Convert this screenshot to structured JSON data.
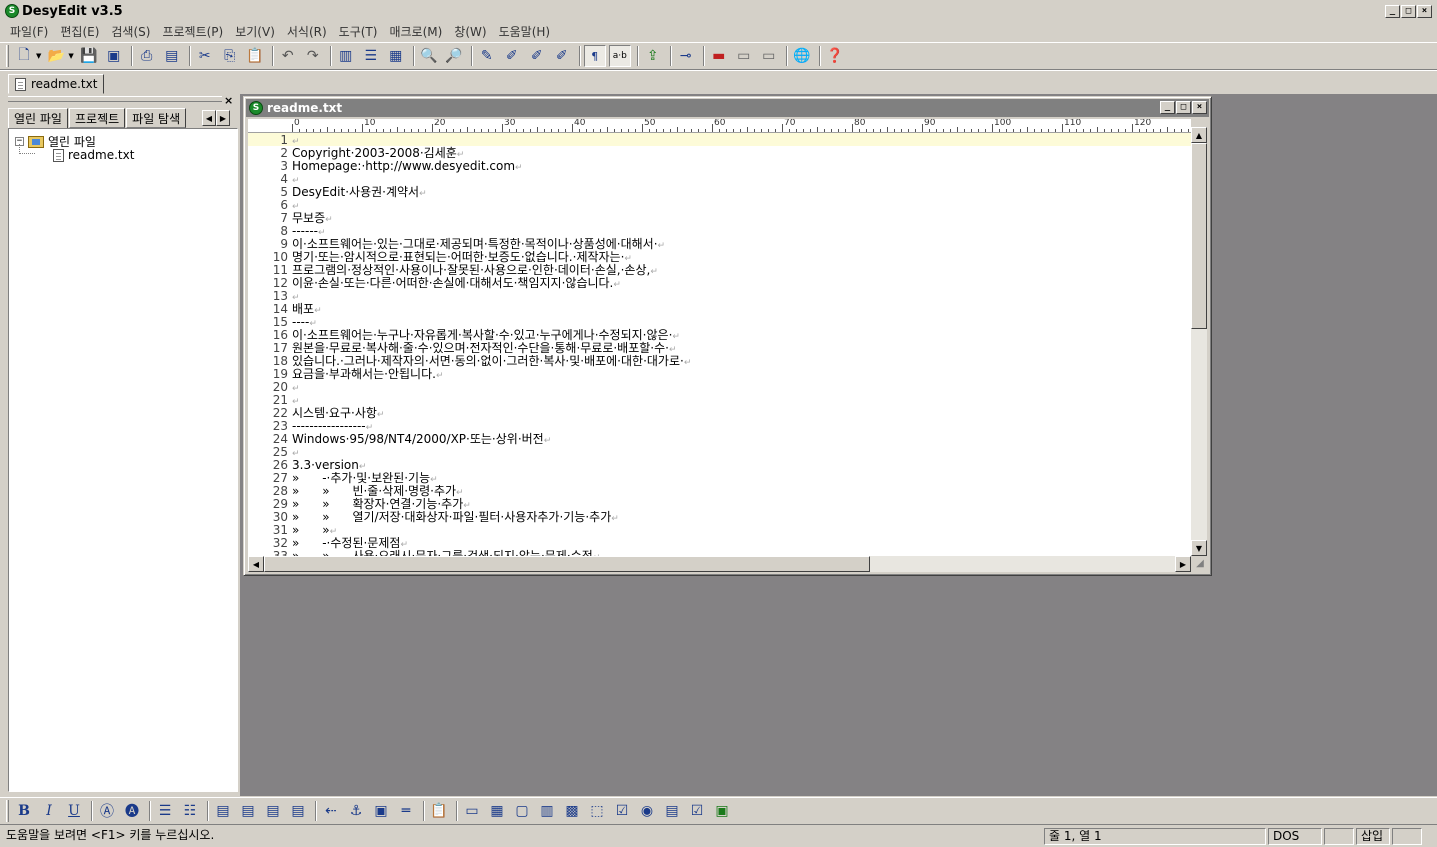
{
  "app": {
    "title": "DesyEdit v3.5",
    "icon": "S"
  },
  "menu": [
    "파일(F)",
    "편집(E)",
    "검색(S)",
    "프로젝트(P)",
    "보기(V)",
    "서식(R)",
    "도구(T)",
    "매크로(M)",
    "창(W)",
    "도움말(H)"
  ],
  "toolbar": {
    "icons": [
      "new-file-icon",
      "open-folder-icon",
      "save-icon",
      "save-all-icon",
      "print-icon",
      "print-preview-icon",
      "cut-icon",
      "copy-icon",
      "paste-icon",
      "undo-icon",
      "redo-icon",
      "column-icon",
      "list-icon",
      "grid-icon",
      "find-icon",
      "replace-icon",
      "highlight-icon",
      "tool-a-icon",
      "tool-b-icon",
      "tool-c-icon",
      "whitespace-icon",
      "word-wrap-icon",
      "export-icon",
      "pin-icon",
      "bookmark-icon",
      "comment-icon",
      "comment2-icon",
      "web-icon",
      "help-icon"
    ],
    "word_wrap_label": "a·b"
  },
  "doc_tabs": [
    {
      "label": "readme.txt"
    }
  ],
  "left_panel": {
    "close": "×",
    "tabs": [
      "열린 파일",
      "프로젝트",
      "파일 탐색"
    ],
    "tree_root": "열린 파일",
    "tree_child": "readme.txt",
    "expander": "−"
  },
  "editor": {
    "title": "readme.txt",
    "ruler_labels": [
      "0",
      "10",
      "20",
      "30",
      "40",
      "50",
      "60",
      "70",
      "80",
      "90",
      "100",
      "110",
      "120"
    ],
    "lines": [
      {
        "n": "1",
        "t": ""
      },
      {
        "n": "2",
        "t": "Copyright·2003-2008·김세훈"
      },
      {
        "n": "3",
        "t": "Homepage:·http://www.desyedit.com"
      },
      {
        "n": "4",
        "t": ""
      },
      {
        "n": "5",
        "t": "DesyEdit·사용권·계약서"
      },
      {
        "n": "6",
        "t": ""
      },
      {
        "n": "7",
        "t": "무보증"
      },
      {
        "n": "8",
        "t": "------"
      },
      {
        "n": "9",
        "t": "이·소프트웨어는·있는·그대로·제공되며·특정한·목적이나·상품성에·대해서·"
      },
      {
        "n": "10",
        "t": "명기·또는·암시적으로·표현되는·어떠한·보증도·없습니다.·제작자는·"
      },
      {
        "n": "11",
        "t": "프로그램의·정상적인·사용이나·잘못된·사용으로·인한·데이터·손실,·손상,"
      },
      {
        "n": "12",
        "t": "이윤·손실·또는·다른·어떠한·손실에·대해서도·책임지지·않습니다."
      },
      {
        "n": "13",
        "t": ""
      },
      {
        "n": "14",
        "t": "배포"
      },
      {
        "n": "15",
        "t": "----"
      },
      {
        "n": "16",
        "t": "이·소프트웨어는·누구나·자유롭게·복사할·수·있고·누구에게나·수정되지·않은·"
      },
      {
        "n": "17",
        "t": "원본을·무료로·복사해·줄·수·있으며·전자적인·수단을·통해·무료로·배포할·수·"
      },
      {
        "n": "18",
        "t": "있습니다.·그러나·제작자의·서면·동의·없이·그러한·복사·및·배포에·대한·대가로·"
      },
      {
        "n": "19",
        "t": "요금을·부과해서는·안됩니다."
      },
      {
        "n": "20",
        "t": ""
      },
      {
        "n": "21",
        "t": ""
      },
      {
        "n": "22",
        "t": "시스템·요구·사항"
      },
      {
        "n": "23",
        "t": "-----------------"
      },
      {
        "n": "24",
        "t": "Windows·95/98/NT4/2000/XP·또는·상위·버전"
      },
      {
        "n": "25",
        "t": ""
      },
      {
        "n": "26",
        "t": "3.3·version"
      },
      {
        "n": "27",
        "t": "»      -·추가·및·보완된·기능"
      },
      {
        "n": "28",
        "t": "»      »      빈·줄·삭제·명령·추가"
      },
      {
        "n": "29",
        "t": "»      »      확장자·연결·기능·추가"
      },
      {
        "n": "30",
        "t": "»      »      열기/저장·대화상자·파일·필터·사용자추가·기능·추가"
      },
      {
        "n": "31",
        "t": "»      »"
      },
      {
        "n": "32",
        "t": "»      -·수정된·문제점"
      },
      {
        "n": "33",
        "t": "»      »      사용·오래시·문자·그룹·검색·되지·않는·문제·수정"
      }
    ],
    "eol_mark": "↵"
  },
  "bottom_toolbar": {
    "bold": "B",
    "italic": "I",
    "underline": "U",
    "icons": [
      "font-color-icon",
      "bg-color-icon",
      "bullets-icon",
      "numbering-icon",
      "align-left-icon",
      "align-center-icon",
      "align-right-icon",
      "align-justify-icon",
      "link-icon",
      "anchor-icon",
      "image-icon",
      "hr-icon",
      "paste-html-icon",
      "frame-icon",
      "table-icon",
      "textbox-icon",
      "input-icon",
      "password-icon",
      "hidden-icon",
      "checkbox-icon",
      "radio-icon",
      "select-icon",
      "submit-icon",
      "reset-icon"
    ]
  },
  "status": {
    "help": "도움말을 보려면 <F1> 키를 누르십시오.",
    "position": "줄 1, 열 1",
    "format": "DOS",
    "blank": "",
    "mode": "삽입"
  }
}
